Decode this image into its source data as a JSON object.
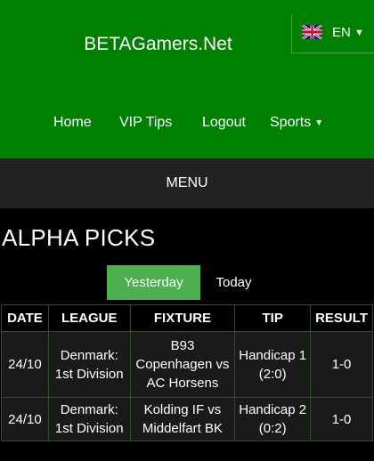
{
  "header": {
    "brand": "BETAGamers.Net"
  },
  "language": {
    "label": "EN",
    "flag_icon": "uk-flag-icon"
  },
  "nav": {
    "items": [
      {
        "label": "Home"
      },
      {
        "label": "VIP Tips"
      },
      {
        "label": "Logout"
      },
      {
        "label": "Sports"
      }
    ]
  },
  "menu": {
    "label": "MENU"
  },
  "page": {
    "title": "ALPHA PICKS"
  },
  "tabs": {
    "yesterday": "Yesterday",
    "today": "Today",
    "active_color": "#4caf50"
  },
  "table": {
    "headers": [
      "DATE",
      "LEAGUE",
      "FIXTURE",
      "TIP",
      "RESULT"
    ],
    "rows": [
      {
        "date": "24/10",
        "league": "Denmark: 1st Division",
        "fixture": "B93 Copenhagen vs AC Horsens",
        "tip": "Handicap 1 (2:0)",
        "result": "1-0"
      },
      {
        "date": "24/10",
        "league": "Denmark: 1st Division",
        "fixture": "Kolding IF vs Middelfart BK",
        "tip": "Handicap 2 (0:2)",
        "result": "1-0"
      }
    ]
  },
  "colors": {
    "header_green": "#008000",
    "menu_bar": "#222222",
    "background": "#000000"
  }
}
